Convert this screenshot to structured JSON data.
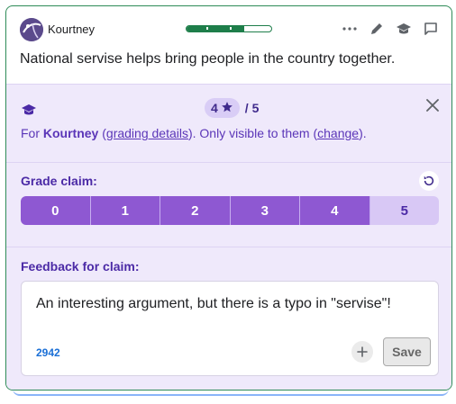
{
  "post": {
    "author": "Kourtney",
    "text": "National servise helps bring people in the country together.",
    "progress_fraction": 0.68
  },
  "header_icons": [
    "more-icon",
    "pencil-icon",
    "graduation-cap-icon",
    "comment-icon"
  ],
  "grading": {
    "score": "4",
    "score_max": "/ 5",
    "for_prefix": "For ",
    "for_name": "Kourtney",
    "open_paren": " (",
    "details_link": "grading details",
    "visible_text": "). Only visible to them (",
    "change_link": "change",
    "end_text": ").",
    "grade_claim_label": "Grade claim:",
    "grade_options": [
      "0",
      "1",
      "2",
      "3",
      "4",
      "5"
    ],
    "selected_grade": "5",
    "feedback_label": "Feedback for claim:",
    "feedback_text": "An interesting argument, but there is a typo in \"servise\"!",
    "feedback_count": "2942",
    "save_label": "Save"
  },
  "colors": {
    "accent": "#8e58d2",
    "accent_dark": "#4b2aa6",
    "panel_bg": "#efe9fb",
    "border_green": "#2e8b57",
    "link_blue": "#1a6fd6"
  }
}
